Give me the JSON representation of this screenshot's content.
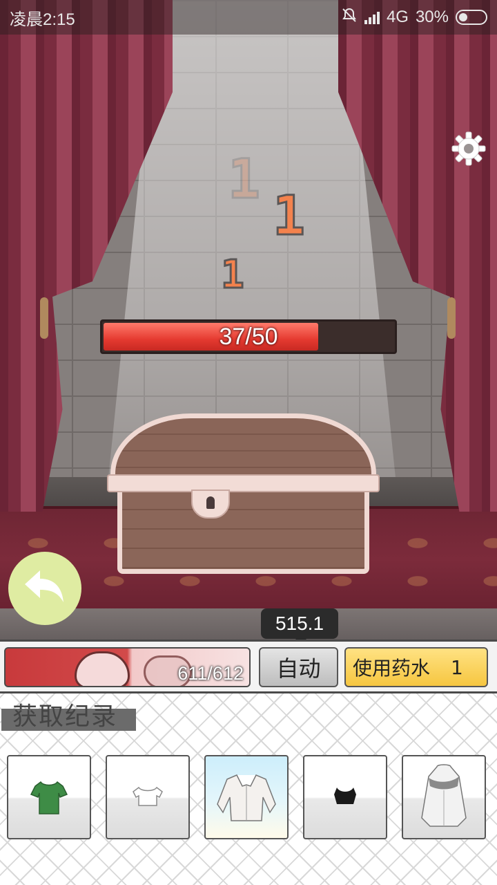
{
  "status_bar": {
    "time": "凌晨2:15",
    "network": "4G",
    "battery": "30%"
  },
  "scene": {
    "damage_numbers": [
      "1",
      "1",
      "1"
    ],
    "chest_hp": {
      "text": "37/50",
      "current": 37,
      "max": 50
    },
    "tooltip_value": "515.1"
  },
  "control_bar": {
    "player_hp": "611/612",
    "auto_label": "自动",
    "potion_label": "使用药水",
    "potion_count": "1"
  },
  "record": {
    "title": "获取纪录",
    "items": [
      {
        "name": "green-tshirt",
        "color": "#3e8c46",
        "highlight": false
      },
      {
        "name": "white-crop-top",
        "color": "#ffffff",
        "highlight": false
      },
      {
        "name": "white-shirt",
        "color": "#f4f1ee",
        "highlight": true
      },
      {
        "name": "black-crop-top",
        "color": "#1a1a1a",
        "highlight": false
      },
      {
        "name": "white-hoodie",
        "color": "#f2f2f2",
        "highlight": false
      }
    ]
  },
  "colors": {
    "hp_fill": "#e53a30",
    "potion_button": "#f6c640",
    "back_button": "#dfeca2"
  },
  "icons": [
    "gear-icon",
    "back-arrow-icon",
    "signal-icon",
    "battery-icon",
    "mute-icon"
  ]
}
